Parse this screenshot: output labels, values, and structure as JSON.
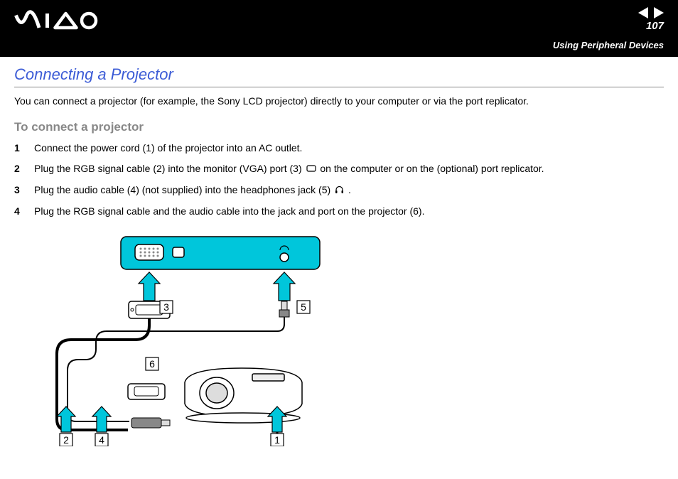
{
  "header": {
    "page_number": "107",
    "section_label": "Using Peripheral Devices",
    "logo_alt": "VAIO"
  },
  "content": {
    "title": "Connecting a Projector",
    "intro": "You can connect a projector (for example, the Sony LCD projector) directly to your computer or via the port replicator.",
    "subtitle": "To connect a projector",
    "steps": [
      {
        "num": "1",
        "text_before": "Connect the power cord (1) of the projector into an AC outlet.",
        "icon": null,
        "text_after": ""
      },
      {
        "num": "2",
        "text_before": "Plug the RGB signal cable (2) into the monitor (VGA) port (3) ",
        "icon": "monitor-icon",
        "text_after": " on the computer or on the (optional) port replicator."
      },
      {
        "num": "3",
        "text_before": "Plug the audio cable (4) (not supplied) into the headphones jack (5) ",
        "icon": "headphones-icon",
        "text_after": "."
      },
      {
        "num": "4",
        "text_before": "Plug the RGB signal cable and the audio cable into the jack and port on the projector (6).",
        "icon": null,
        "text_after": ""
      }
    ],
    "diagram_labels": {
      "l1": "1",
      "l2": "2",
      "l3": "3",
      "l4": "4",
      "l5": "5",
      "l6": "6"
    }
  }
}
